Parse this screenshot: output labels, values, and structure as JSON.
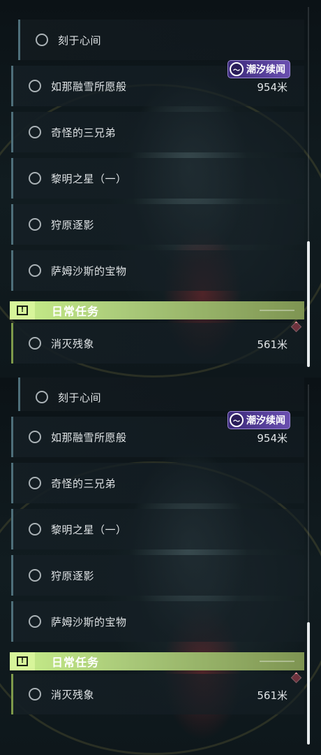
{
  "quests": {
    "item_1": "刻于心间",
    "item_2": "如那融雪所愿般",
    "item_2_distance": "954米",
    "item_2_tag": "潮汐续闻",
    "item_3": "奇怪的三兄弟",
    "item_4": "黎明之星（一）",
    "item_5": "狩原逐影",
    "item_6": "萨姆沙斯的宝物"
  },
  "daily": {
    "title": "日常任务",
    "icon": "!",
    "item_1": "消灭残象",
    "item_1_distance": "561米"
  },
  "icons": {
    "quest_status": "circle-icon",
    "tag": "wave-icon",
    "section": "alert-icon",
    "marker": "diamond-icon"
  },
  "colors": {
    "tag": "#6a4fb0",
    "section": "#c8ef8a",
    "marker": "#e24b5c"
  }
}
